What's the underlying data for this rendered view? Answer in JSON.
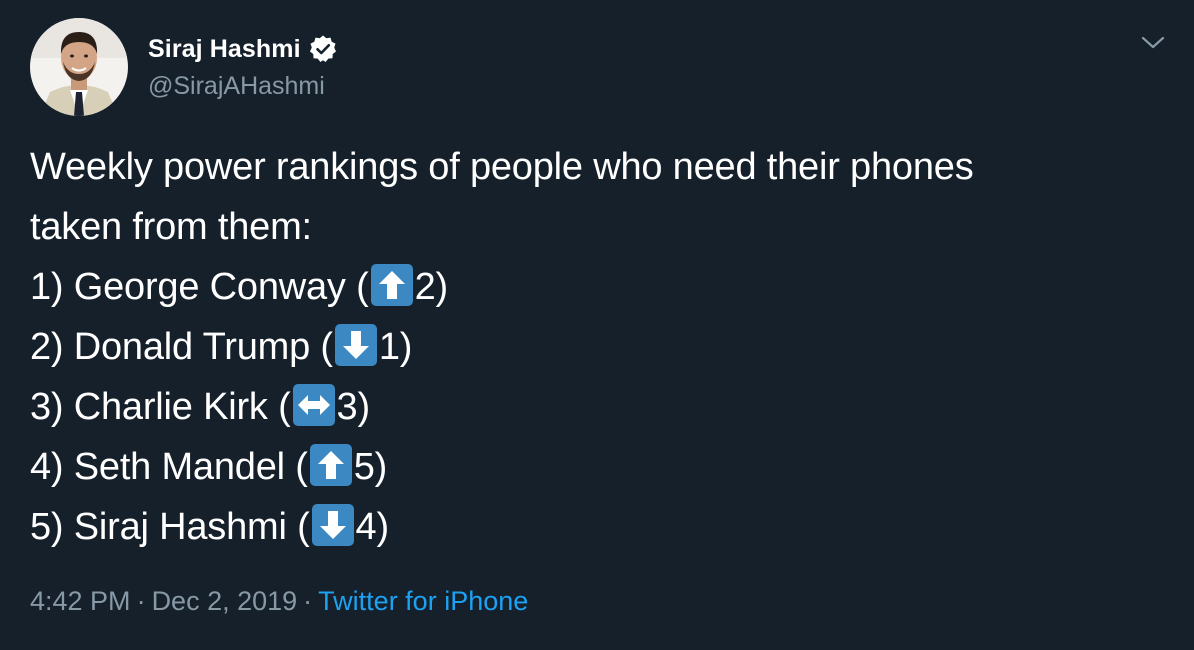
{
  "author": {
    "display_name": "Siraj Hashmi",
    "handle": "@SirajAHashmi",
    "verified": true,
    "avatar": "profile-photo"
  },
  "tweet": {
    "intro_lines": [
      "Weekly power rankings of people who need their phones",
      "taken from them:"
    ],
    "rankings": [
      {
        "prefix": "1) George Conway (",
        "arrow": "up-arrow-icon",
        "number": "2",
        "suffix": ")"
      },
      {
        "prefix": "2) Donald Trump (",
        "arrow": "down-arrow-icon",
        "number": "1",
        "suffix": ")"
      },
      {
        "prefix": "3) Charlie Kirk (",
        "arrow": "left-right-arrow-icon",
        "number": "3",
        "suffix": ")"
      },
      {
        "prefix": "4) Seth Mandel (",
        "arrow": "up-arrow-icon",
        "number": "5",
        "suffix": ")"
      },
      {
        "prefix": "5) Siraj Hashmi (",
        "arrow": "down-arrow-icon",
        "number": "4",
        "suffix": ")"
      }
    ]
  },
  "meta": {
    "time": "4:42 PM",
    "separator": "·",
    "date": "Dec 2, 2019",
    "source": "Twitter for iPhone"
  },
  "colors": {
    "background": "#15202b",
    "text": "#ffffff",
    "secondary_text": "#8899a6",
    "link": "#1da1f2",
    "emoji_box": "#3b88c3"
  },
  "icons": {
    "verified": "verified-badge-icon",
    "caret": "chevron-down-icon"
  }
}
